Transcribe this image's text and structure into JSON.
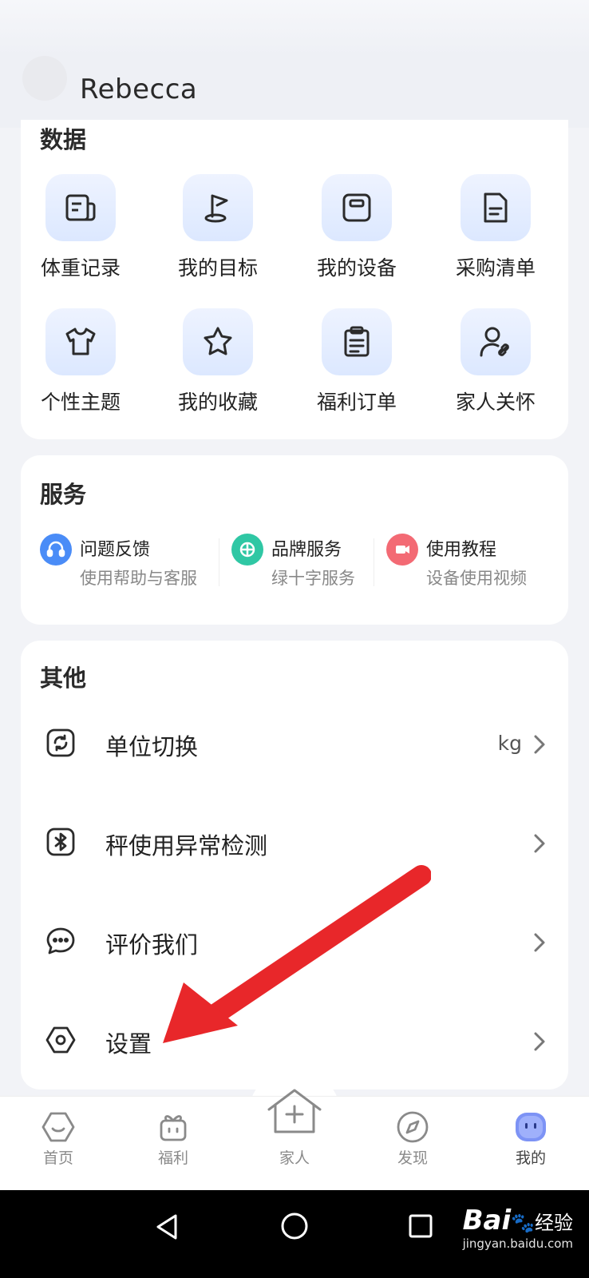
{
  "user": {
    "name": "Rebecca"
  },
  "data_section": {
    "title": "数据",
    "items": [
      {
        "label": "体重记录",
        "icon": "weight-record-icon"
      },
      {
        "label": "我的目标",
        "icon": "flag-icon"
      },
      {
        "label": "我的设备",
        "icon": "scale-device-icon"
      },
      {
        "label": "采购清单",
        "icon": "document-icon"
      },
      {
        "label": "个性主题",
        "icon": "shirt-icon"
      },
      {
        "label": "我的收藏",
        "icon": "star-icon"
      },
      {
        "label": "福利订单",
        "icon": "clipboard-icon"
      },
      {
        "label": "家人关怀",
        "icon": "family-link-icon"
      }
    ]
  },
  "services_section": {
    "title": "服务",
    "items": [
      {
        "name": "问题反馈",
        "sub": "使用帮助与客服",
        "color": "#4a8cf7"
      },
      {
        "name": "品牌服务",
        "sub": "绿十字服务",
        "color": "#2fc7a4"
      },
      {
        "name": "使用教程",
        "sub": "设备使用视频",
        "color": "#f36a74"
      }
    ]
  },
  "other_section": {
    "title": "其他",
    "items": [
      {
        "label": "单位切换",
        "value": "kg",
        "icon": "unit-switch-icon"
      },
      {
        "label": "秤使用异常检测",
        "value": "",
        "icon": "bluetooth-icon"
      },
      {
        "label": "评价我们",
        "value": "",
        "icon": "chat-bubble-icon"
      },
      {
        "label": "设置",
        "value": "",
        "icon": "settings-hexagon-icon"
      }
    ]
  },
  "bottom_nav": {
    "items": [
      {
        "label": "首页",
        "icon": "home-icon"
      },
      {
        "label": "福利",
        "icon": "gift-icon"
      },
      {
        "label": "家人",
        "icon": "family-add-icon"
      },
      {
        "label": "发现",
        "icon": "compass-icon"
      },
      {
        "label": "我的",
        "icon": "profile-face-icon",
        "active": true
      }
    ]
  },
  "watermark": {
    "brand": "Bai",
    "brand_suffix": "经验",
    "url": "jingyan.baidu.com"
  },
  "colors": {
    "accent": "#4a7cf0",
    "annotation": "#e8272a",
    "icon_stroke": "#2b2b2b"
  }
}
